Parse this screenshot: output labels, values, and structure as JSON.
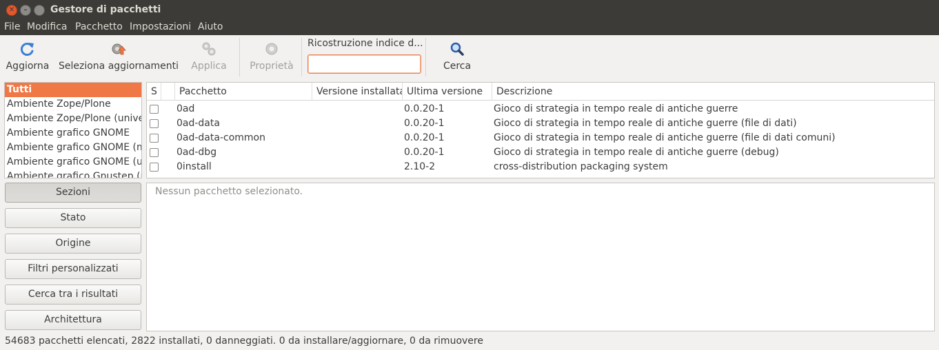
{
  "window": {
    "title": "Gestore di pacchetti"
  },
  "menubar": {
    "items": [
      "File",
      "Modifica",
      "Pacchetto",
      "Impostazioni",
      "Aiuto"
    ]
  },
  "toolbar": {
    "reload_label": "Aggiorna",
    "mark_upgrades_label": "Seleziona aggiornamenti",
    "apply_label": "Applica",
    "properties_label": "Proprietà",
    "search_label": "Ricostruzione indice d...",
    "search_value": "",
    "search_button_label": "Cerca"
  },
  "sections": {
    "items": [
      "Tutti",
      "Ambiente Zope/Plone",
      "Ambiente Zope/Plone (universe)",
      "Ambiente grafico GNOME",
      "Ambiente grafico GNOME (multiverse)",
      "Ambiente grafico GNOME (universe)",
      "Ambiente grafico Gnustep (universe)"
    ],
    "selected_index": 0
  },
  "filters": {
    "sections": "Sezioni",
    "status": "Stato",
    "origin": "Origine",
    "custom": "Filtri personalizzati",
    "search_results": "Cerca tra i risultati",
    "architecture": "Architettura"
  },
  "package_table": {
    "columns": {
      "status": "S",
      "package": "Pacchetto",
      "installed": "Versione installata",
      "latest": "Ultima versione",
      "description": "Descrizione"
    },
    "rows": [
      {
        "package": "0ad",
        "installed": "",
        "latest": "0.0.20-1",
        "description": "Gioco di strategia in tempo reale di antiche guerre"
      },
      {
        "package": "0ad-data",
        "installed": "",
        "latest": "0.0.20-1",
        "description": "Gioco di strategia in tempo reale di antiche guerre (file di dati)"
      },
      {
        "package": "0ad-data-common",
        "installed": "",
        "latest": "0.0.20-1",
        "description": "Gioco di strategia in tempo reale di antiche guerre  (file di dati comuni)"
      },
      {
        "package": "0ad-dbg",
        "installed": "",
        "latest": "0.0.20-1",
        "description": "Gioco di strategia in tempo reale di antiche guerre (debug)"
      },
      {
        "package": "0install",
        "installed": "",
        "latest": "2.10-2",
        "description": "cross-distribution packaging system"
      }
    ]
  },
  "details": {
    "text": "Nessun pacchetto selezionato."
  },
  "statusbar": {
    "text": "54683 pacchetti elencati, 2822 installati, 0 danneggiati. 0 da installare/aggiornare, 0 da rimuovere"
  },
  "colors": {
    "accent": "#f07746",
    "titlebar": "#3c3b37",
    "close": "#e4582b"
  }
}
